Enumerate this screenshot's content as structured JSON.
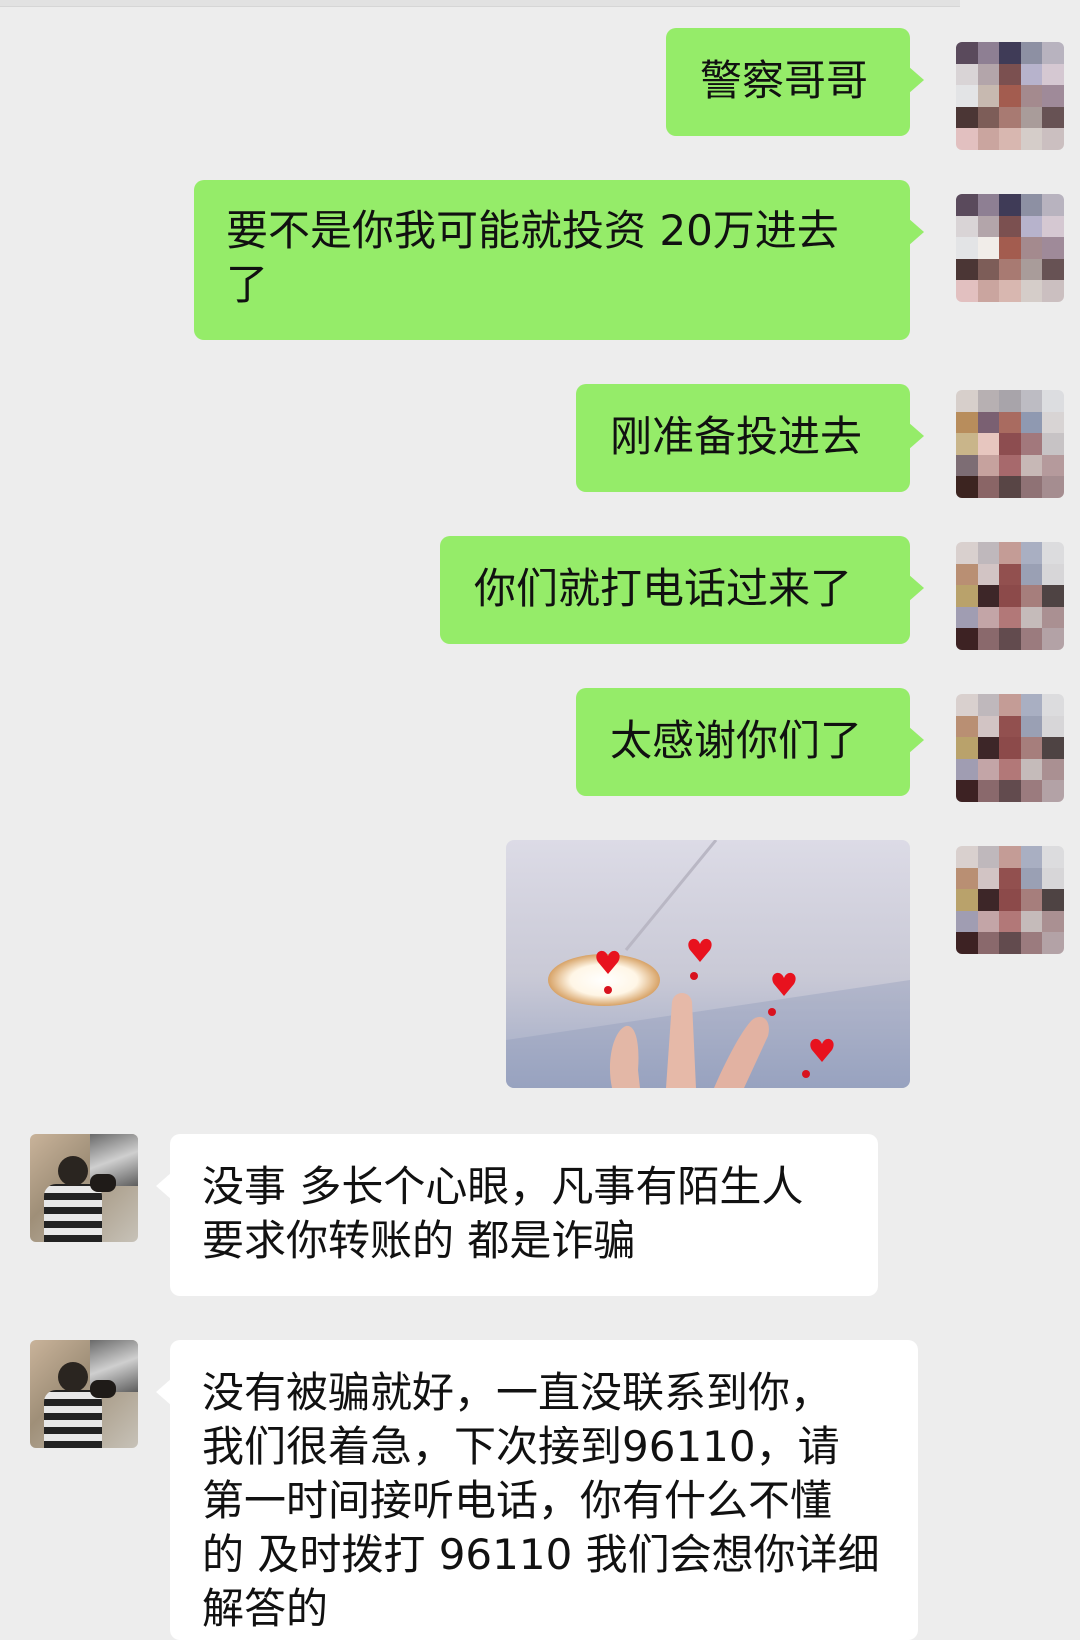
{
  "messages": [
    {
      "id": "m1",
      "sender": "me",
      "type": "text",
      "text": "警察哥哥"
    },
    {
      "id": "m2",
      "sender": "me",
      "type": "text",
      "text": "要不是你我可能就投资 20万进去\n了"
    },
    {
      "id": "m3",
      "sender": "me",
      "type": "text",
      "text": "刚准备投进去"
    },
    {
      "id": "m4",
      "sender": "me",
      "type": "text",
      "text": "你们就打电话过来了"
    },
    {
      "id": "m5",
      "sender": "me",
      "type": "text",
      "text": "太感谢你们了"
    },
    {
      "id": "m6",
      "sender": "me",
      "type": "image"
    },
    {
      "id": "m7",
      "sender": "other",
      "type": "text",
      "text": "没事 多长个心眼，凡事有陌生人\n要求你转账的 都是诈骗"
    },
    {
      "id": "m8",
      "sender": "other",
      "type": "text",
      "text": "没有被骗就好，一直没联系到你，\n我们很着急，下次接到96110，请\n第一时间接听电话，你有什么不懂\n的 及时拨打 96110 我们会想你详细\n解答的"
    }
  ],
  "colors": {
    "background": "#ededed",
    "my_bubble": "#95ec69",
    "their_bubble": "#ffffff",
    "text": "#111111"
  }
}
